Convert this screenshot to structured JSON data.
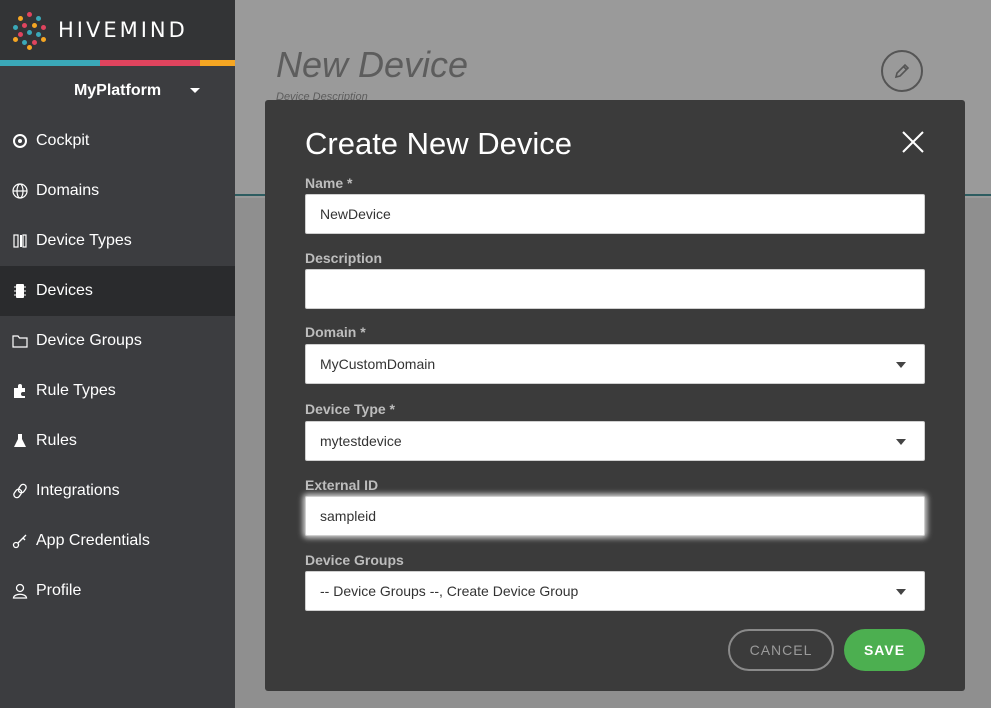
{
  "brand": {
    "name": "HIVEMIND",
    "stripe_colors": [
      "#3aa8b8",
      "#e0445e",
      "#f5a623"
    ]
  },
  "platform": {
    "selected": "MyPlatform"
  },
  "sidebar": {
    "items": [
      {
        "label": "Cockpit",
        "icon": "compass-icon"
      },
      {
        "label": "Domains",
        "icon": "globe-icon"
      },
      {
        "label": "Device Types",
        "icon": "device-types-icon"
      },
      {
        "label": "Devices",
        "icon": "chip-icon"
      },
      {
        "label": "Device Groups",
        "icon": "folder-icon"
      },
      {
        "label": "Rule Types",
        "icon": "puzzle-icon"
      },
      {
        "label": "Rules",
        "icon": "flask-icon"
      },
      {
        "label": "Integrations",
        "icon": "link-icon"
      },
      {
        "label": "App Credentials",
        "icon": "key-icon"
      },
      {
        "label": "Profile",
        "icon": "user-icon"
      }
    ],
    "active": "Devices"
  },
  "page": {
    "title": "New Device",
    "subtitle": "Device Description"
  },
  "modal": {
    "title": "Create New Device",
    "fields": {
      "name": {
        "label": "Name *",
        "value": "NewDevice"
      },
      "description": {
        "label": "Description",
        "value": ""
      },
      "domain": {
        "label": "Domain *",
        "value": "MyCustomDomain"
      },
      "device_type": {
        "label": "Device Type *",
        "value": "mytestdevice"
      },
      "external_id": {
        "label": "External ID",
        "value": "sampleid"
      },
      "device_groups": {
        "label": "Device Groups",
        "value": "-- Device Groups --, Create Device Group"
      }
    },
    "cancel_label": "CANCEL",
    "save_label": "SAVE",
    "save_color": "#4caf50"
  }
}
